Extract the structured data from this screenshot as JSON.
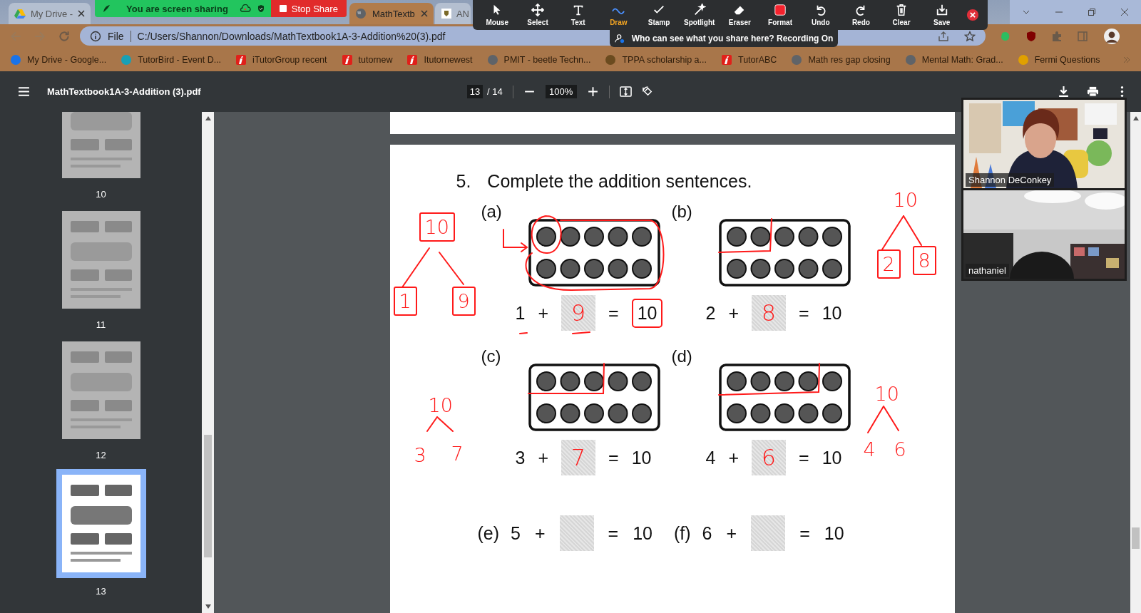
{
  "browser": {
    "tabs": [
      {
        "title": "My Drive -",
        "selected": false,
        "kind": "drive"
      },
      {
        "title": "MathTextb",
        "selected": true,
        "kind": "globe"
      },
      {
        "title": "AN",
        "selected": false,
        "kind": "crest"
      }
    ],
    "address": {
      "scheme": "File",
      "url": "C:/Users/Shannon/Downloads/MathTextbook1A-3-Addition%20(3).pdf"
    },
    "bookmarks": [
      {
        "title": "My Drive - Google...",
        "kind": "drive"
      },
      {
        "title": "TutorBird - Event D...",
        "kind": "bird"
      },
      {
        "title": "iTutorGroup recent",
        "kind": "itutor"
      },
      {
        "title": "tutornew",
        "kind": "itutor"
      },
      {
        "title": "Itutornewest",
        "kind": "itutor"
      },
      {
        "title": "PMIT - beetle Techn...",
        "kind": "globe"
      },
      {
        "title": "TPPA scholarship a...",
        "kind": "crest"
      },
      {
        "title": "TutorABC",
        "kind": "itutor"
      },
      {
        "title": "Math res gap closing",
        "kind": "globe"
      },
      {
        "title": "Mental Math: Grad...",
        "kind": "globe"
      },
      {
        "title": "Fermi Questions",
        "kind": "fermi"
      }
    ]
  },
  "share_bar": {
    "status": "You are screen sharing",
    "stop": "Stop Share"
  },
  "annotate_toolbar": {
    "tools": [
      {
        "label": "Mouse",
        "kind": "mouse",
        "selected": false
      },
      {
        "label": "Select",
        "kind": "select",
        "selected": false
      },
      {
        "label": "Text",
        "kind": "text",
        "selected": false
      },
      {
        "label": "Draw",
        "kind": "draw",
        "selected": true
      },
      {
        "label": "Stamp",
        "kind": "stamp",
        "selected": false
      },
      {
        "label": "Spotlight",
        "kind": "spotlight",
        "selected": false
      },
      {
        "label": "Eraser",
        "kind": "eraser",
        "selected": false
      },
      {
        "label": "Format",
        "kind": "format",
        "selected": false
      },
      {
        "label": "Undo",
        "kind": "undo",
        "selected": false
      },
      {
        "label": "Redo",
        "kind": "redo",
        "selected": false
      },
      {
        "label": "Clear",
        "kind": "clear",
        "selected": false
      },
      {
        "label": "Save",
        "kind": "save",
        "selected": false
      }
    ],
    "notice": "Who can see what you share here? Recording On"
  },
  "pdf_viewer": {
    "title": "MathTextbook1A-3-Addition (3).pdf",
    "page": "13",
    "page_count": "/ 14",
    "zoom": "100%",
    "thumbnails": [
      {
        "label": "10",
        "selected": false
      },
      {
        "label": "11",
        "selected": false
      },
      {
        "label": "12",
        "selected": false
      },
      {
        "label": "13",
        "selected": true
      }
    ]
  },
  "page": {
    "number": "5.",
    "instruction": "Complete the addition sentences.",
    "problems": [
      {
        "kind": "frame",
        "label": "(a)",
        "addend": "1",
        "plus": "+",
        "answer": "9",
        "equals": "=",
        "total": "10",
        "total_circled": true
      },
      {
        "kind": "frame",
        "label": "(b)",
        "addend": "2",
        "plus": "+",
        "answer": "8",
        "equals": "=",
        "total": "10",
        "total_circled": false
      },
      {
        "kind": "frame",
        "label": "(c)",
        "addend": "3",
        "plus": "+",
        "answer": "7",
        "equals": "=",
        "total": "10",
        "total_circled": false
      },
      {
        "kind": "frame",
        "label": "(d)",
        "addend": "4",
        "plus": "+",
        "answer": "6",
        "equals": "=",
        "total": "10",
        "total_circled": false
      },
      {
        "kind": "plain",
        "label": "(e)",
        "addend": "5",
        "plus": "+",
        "equals": "=",
        "total": "10",
        "total_circled": false
      },
      {
        "kind": "plain",
        "label": "(f)",
        "addend": "6",
        "plus": "+",
        "equals": "=",
        "total": "10",
        "total_circled": false
      }
    ],
    "annotations": [
      {
        "text": "10",
        "boxed": true
      },
      {
        "text": "1",
        "boxed": true
      },
      {
        "text": "9",
        "boxed": true
      },
      {
        "text": "10",
        "boxed": false
      },
      {
        "text": "2",
        "boxed": true
      },
      {
        "text": "8",
        "boxed": true
      },
      {
        "text": "10",
        "boxed": false
      },
      {
        "text": "3",
        "boxed": false
      },
      {
        "text": "7",
        "boxed": false
      },
      {
        "text": "10",
        "boxed": false
      },
      {
        "text": "4",
        "boxed": false
      },
      {
        "text": "6",
        "boxed": false
      }
    ]
  },
  "video": [
    {
      "name": "Shannon DeConkey",
      "kind": "teacher"
    },
    {
      "name": "nathaniel",
      "kind": "student"
    }
  ]
}
